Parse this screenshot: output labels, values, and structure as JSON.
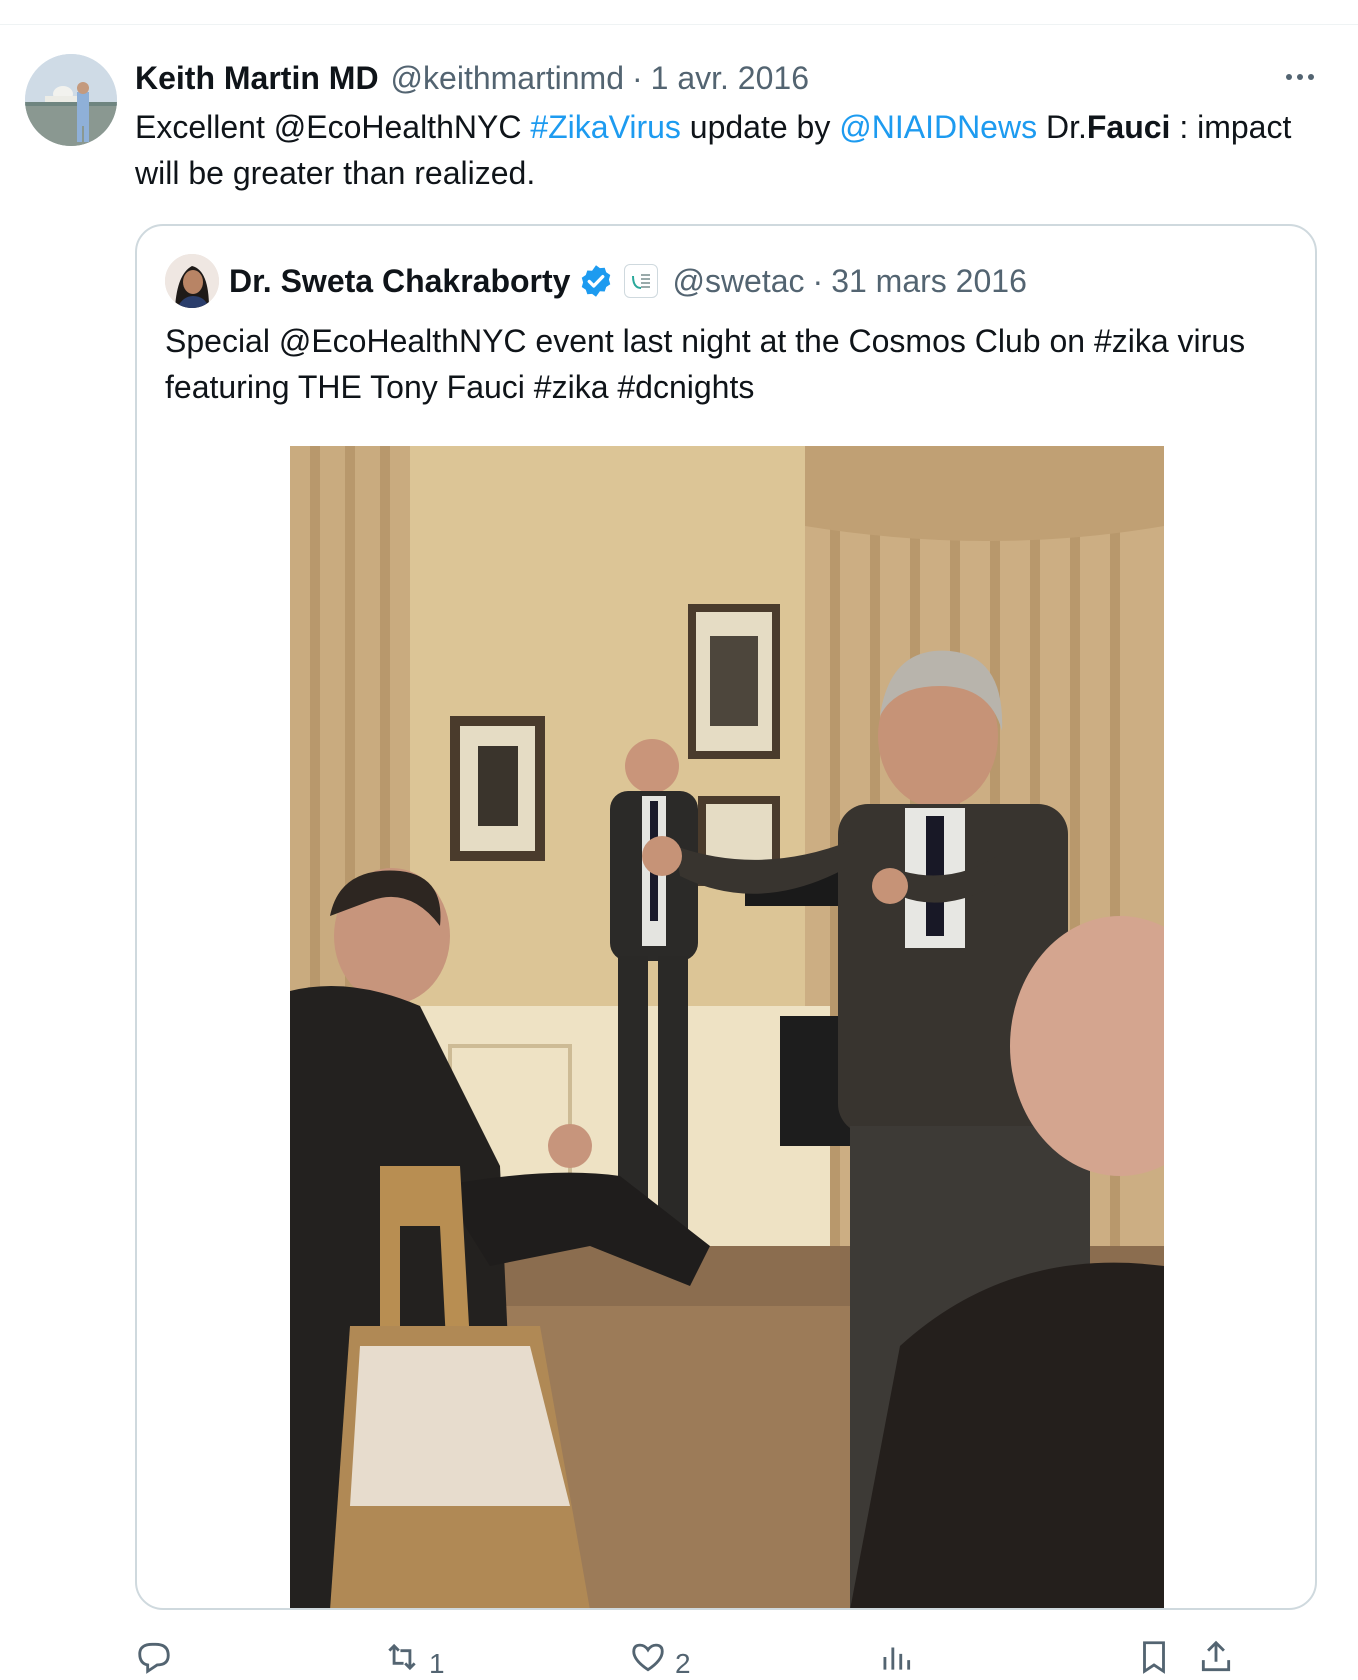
{
  "post": {
    "author_name": "Keith Martin MD",
    "author_handle": "@keithmartinmd",
    "separator": "·",
    "date": "1 avr. 2016",
    "text": {
      "t1": "Excellent @EcoHealthNYC ",
      "hashtag": "#ZikaVirus",
      "t2": " update by ",
      "mention": "@NIAIDNews",
      "t3": " Dr.",
      "bold": "Fauci",
      "t4": " : impact will be greater than realized."
    }
  },
  "quoted": {
    "author_name": "Dr. Sweta Chakraborty",
    "author_handle": "@swetac",
    "separator": "·",
    "date": "31 mars 2016",
    "text": "Special @EcoHealthNYC event last night at the Cosmos Club on #zika virus featuring THE Tony Fauci #zika #dcnights"
  },
  "actions": {
    "reply": "",
    "repost": "1",
    "like": "2",
    "views": ""
  },
  "icons": [
    "more-icon",
    "verified-icon",
    "affiliate-badge-icon",
    "reply-icon",
    "repost-icon",
    "like-icon",
    "views-icon",
    "bookmark-icon",
    "share-icon"
  ],
  "colors": {
    "link": "#1d9bf0",
    "secondary_text": "#536471",
    "border": "#cfd9de",
    "verified": "#1d9bf0"
  }
}
